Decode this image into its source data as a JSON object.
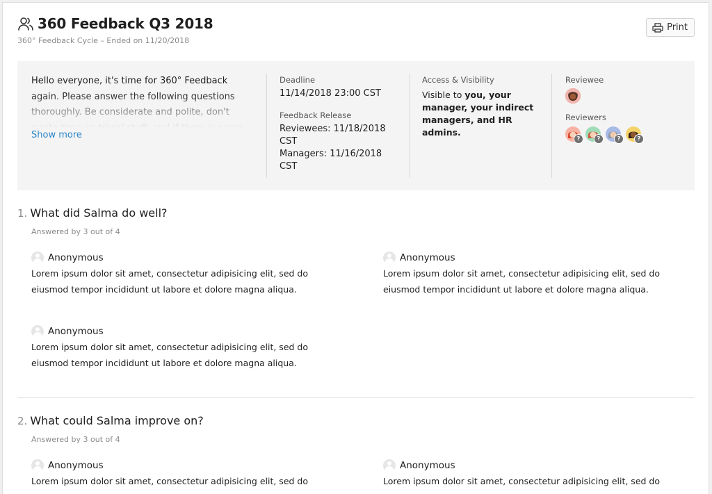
{
  "header": {
    "title": "360 Feedback Q3 2018",
    "subtitle": "360° Feedback Cycle – Ended on 11/20/2018",
    "print_label": "Print",
    "title_icon": "people-icon",
    "print_icon": "printer-icon"
  },
  "info": {
    "intro": "Hello everyone, it's time for 360° Feedback again. Please answer the following questions thoroughly. Be considerate and polite, don't waste time on trivial stuff, and if there is some really, really",
    "show_more": "Show more",
    "deadline_label": "Deadline",
    "deadline_value": "11/14/2018 23:00 CST",
    "release_label": "Feedback Release",
    "release_reviewees": "Reviewees: 11/18/2018 CST",
    "release_managers": "Managers: 11/16/2018 CST",
    "access_label": "Access & Visibility",
    "access_prefix": "Visible to ",
    "access_value": "you, your manager, your indirect managers, and HR admins.",
    "reviewee_label": "Reviewee",
    "reviewers_label": "Reviewers",
    "reviewer_badge": "?",
    "accent": "#2a86c9"
  },
  "questions": [
    {
      "number": "1.",
      "text": "What did Salma do well?",
      "answered": "Answered by 3 out of 4",
      "answers": [
        {
          "author": "Anonymous",
          "body": "Lorem ipsum dolor sit amet, consectetur adipisicing elit, sed do eiusmod tempor incididunt ut labore et dolore magna aliqua."
        },
        {
          "author": "Anonymous",
          "body": "Lorem ipsum dolor sit amet, consectetur adipisicing elit, sed do eiusmod tempor incididunt ut labore et dolore magna aliqua."
        },
        {
          "author": "Anonymous",
          "body": "Lorem ipsum dolor sit amet, consectetur adipisicing elit, sed do eiusmod tempor incididunt ut labore et dolore magna aliqua."
        }
      ]
    },
    {
      "number": "2.",
      "text": "What could Salma improve on?",
      "answered": "Answered by 3 out of 4",
      "answers": [
        {
          "author": "Anonymous",
          "body": "Lorem ipsum dolor sit amet, consectetur adipisicing elit, sed do"
        },
        {
          "author": "Anonymous",
          "body": "Lorem ipsum dolor sit amet, consectetur adipisicing elit, sed do"
        }
      ]
    }
  ]
}
